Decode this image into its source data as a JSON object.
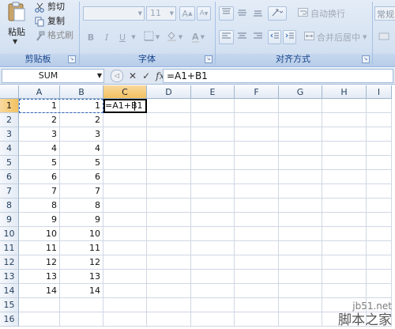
{
  "ribbon": {
    "clipboard": {
      "paste_label": "粘贴",
      "cut_label": "剪切",
      "copy_label": "复制",
      "format_painter_label": "格式刷",
      "group_label": "剪贴板"
    },
    "font": {
      "font_name_value": "",
      "font_size_value": "11",
      "grow_label": "A",
      "shrink_label": "A",
      "bold_label": "B",
      "italic_label": "I",
      "underline_label": "U",
      "group_label": "字体"
    },
    "alignment": {
      "wrap_text_label": "自动换行",
      "merge_center_label": "合并后居中",
      "group_label": "对齐方式"
    },
    "number": {
      "format_value": "常规"
    }
  },
  "formula_bar": {
    "name_box": "SUM",
    "formula": "=A1+B1"
  },
  "sheet": {
    "columns": [
      "A",
      "B",
      "C",
      "D",
      "E",
      "F",
      "G",
      "H",
      "I"
    ],
    "rows": [
      "1",
      "2",
      "3",
      "4",
      "5",
      "6",
      "7",
      "8",
      "9",
      "10",
      "11",
      "12",
      "13",
      "14",
      "15",
      "16"
    ],
    "colA": [
      "1",
      "2",
      "3",
      "4",
      "5",
      "6",
      "7",
      "8",
      "9",
      "10",
      "11",
      "12",
      "13",
      "14"
    ],
    "colB": [
      "1",
      "2",
      "3",
      "4",
      "5",
      "6",
      "7",
      "8",
      "9",
      "10",
      "11",
      "12",
      "13",
      "14"
    ],
    "c1_edit": "=A1+B1"
  },
  "watermark": {
    "line1": "jb51.net",
    "line2": "脚本之家"
  }
}
